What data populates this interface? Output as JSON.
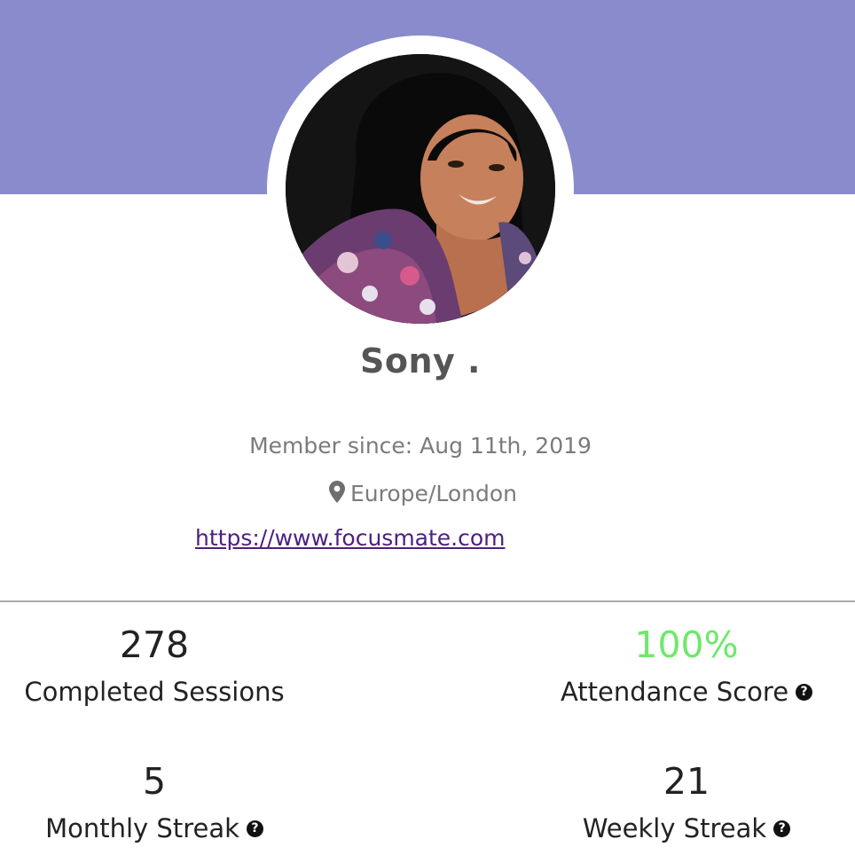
{
  "profile": {
    "name": "Sony .",
    "member_since": "Member since: Aug 11th, 2019",
    "location": "Europe/London",
    "website": "https://www.focusmate.com"
  },
  "stats": {
    "completed_sessions": {
      "value": "278",
      "label": "Completed Sessions"
    },
    "attendance_score": {
      "value": "100%",
      "label": "Attendance Score"
    },
    "monthly_streak": {
      "value": "5",
      "label": "Monthly Streak"
    },
    "weekly_streak": {
      "value": "21",
      "label": "Weekly Streak"
    }
  },
  "icons": {
    "location": "map-pin-icon",
    "help": "question-circle-icon"
  },
  "help_glyph": "?",
  "colors": {
    "banner": "#8a8bcc",
    "attendance_value": "#6ee86b",
    "link": "#4e2080",
    "text_muted": "#7b7b7b",
    "text_dark": "#222222"
  }
}
